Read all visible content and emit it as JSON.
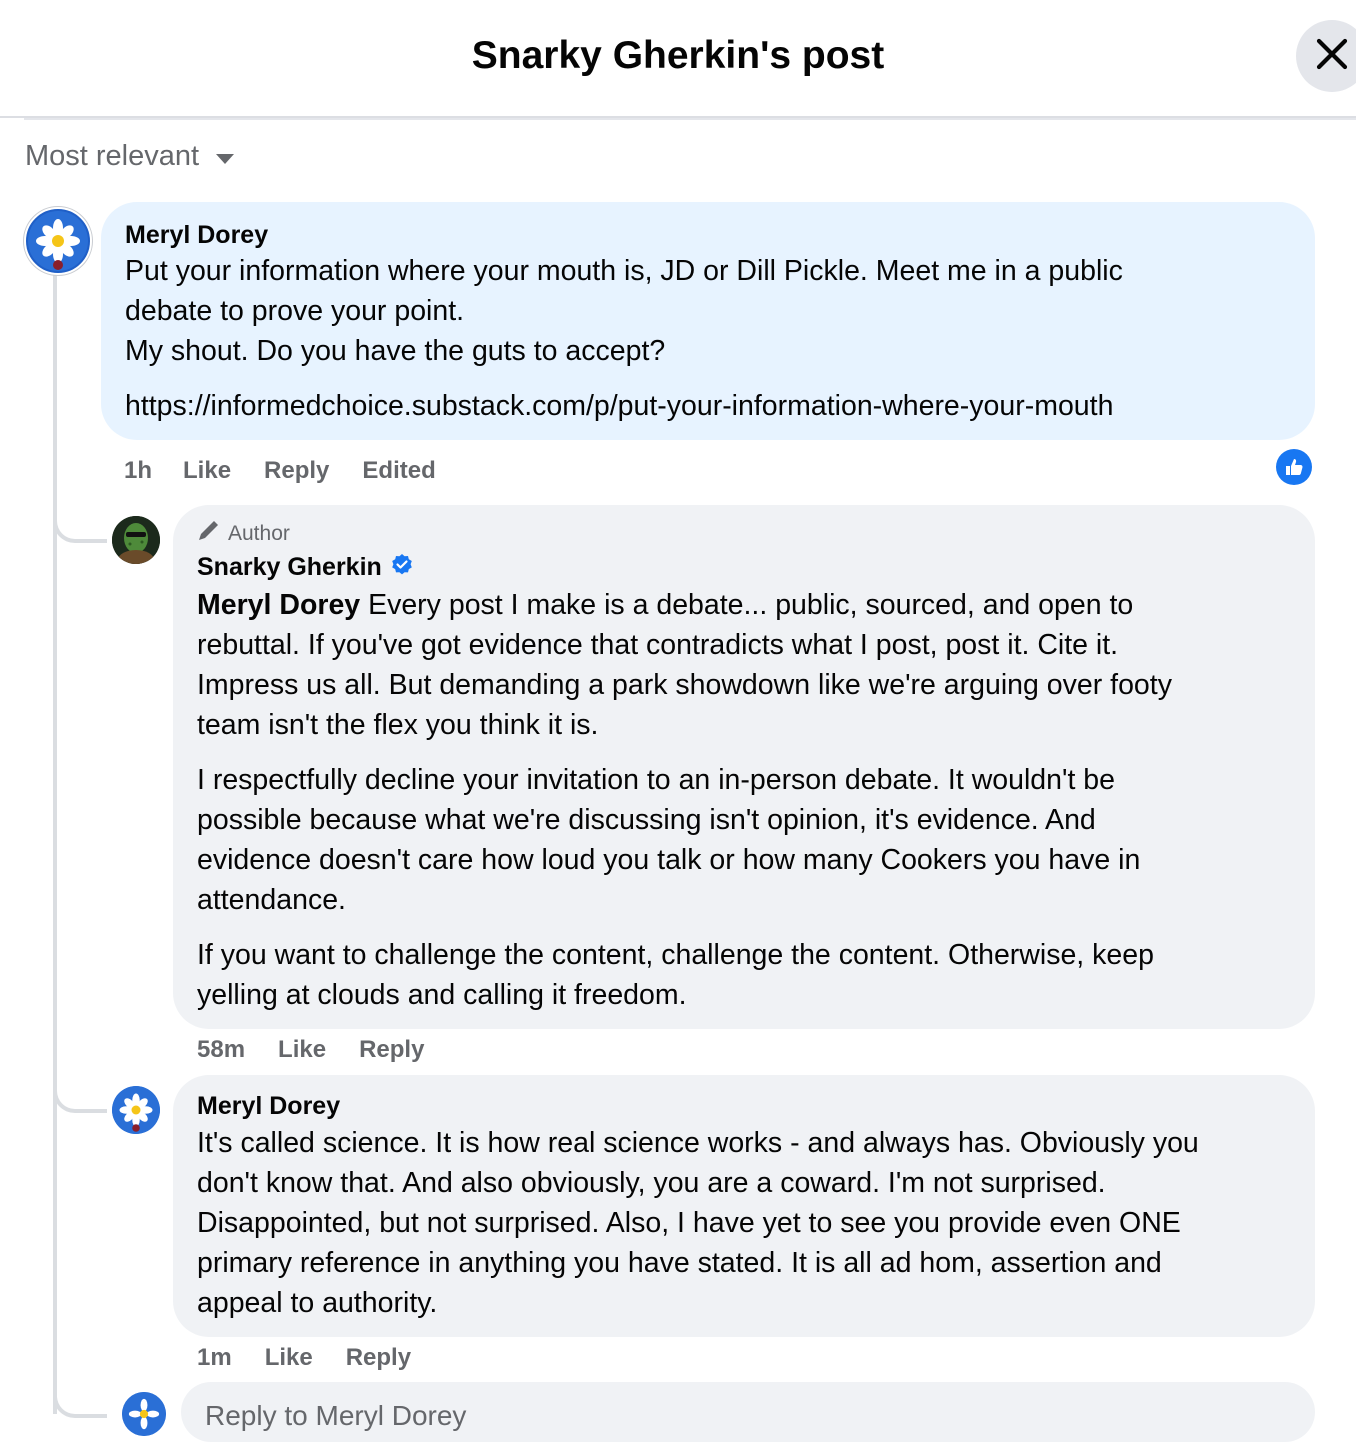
{
  "header": {
    "title": "Snarky Gherkin's post"
  },
  "sort": {
    "label": "Most relevant"
  },
  "comments": [
    {
      "author": "Meryl Dorey",
      "lines": [
        "Put your information where your mouth is, JD or Dill Pickle. Meet me in a public",
        "debate to prove your point.",
        "My shout. Do you have the guts to accept?"
      ],
      "link": "https://informedchoice.substack.com/p/put-your-information-where-your-mouth",
      "time": "1h",
      "like_label": "Like",
      "reply_label": "Reply",
      "edited_label": "Edited"
    },
    {
      "badge": "Author",
      "author": "Snarky Gherkin",
      "mention": "Meryl Dorey",
      "paragraph1": [
        " Every post I make is a debate... public, sourced, and open to",
        "rebuttal. If you've got evidence that contradicts what I post, post it. Cite it.",
        "Impress us all. But demanding a park showdown like we're arguing over footy",
        "team isn't the flex you think it is."
      ],
      "paragraph2": [
        "I respectfully decline your invitation to an in-person debate. It wouldn't be",
        "possible because what we're discussing isn't opinion, it's evidence. And",
        "evidence doesn't care how loud you talk or how many Cookers you have in",
        "attendance."
      ],
      "paragraph3": [
        "If you want to challenge the content, challenge the content. Otherwise, keep",
        "yelling at clouds and calling it freedom."
      ],
      "time": "58m",
      "like_label": "Like",
      "reply_label": "Reply"
    },
    {
      "author": "Meryl Dorey",
      "lines": [
        "It's called science. It is how real science works - and always has. Obviously you",
        "don't know that. And also obviously, you are a coward. I'm not surprised.",
        "Disappointed, but not surprised. Also, I have yet to see you provide even ONE",
        "primary reference in anything you have stated. It is all ad hom, assertion and",
        "appeal to authority."
      ],
      "time": "1m",
      "like_label": "Like",
      "reply_label": "Reply"
    }
  ],
  "reply_box": {
    "placeholder": "Reply to Meryl Dorey"
  },
  "colors": {
    "accent": "#1877f2",
    "bubble_highlight": "#e7f3ff",
    "bubble": "#f0f2f5",
    "muted": "#65676b"
  }
}
